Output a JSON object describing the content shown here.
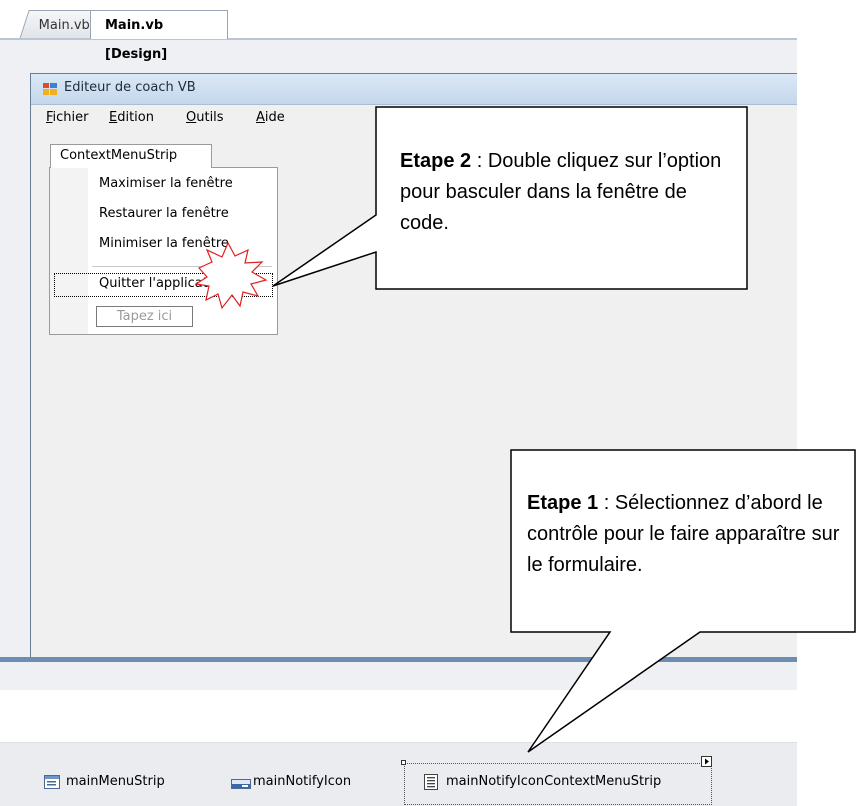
{
  "tabs": [
    {
      "label": "Main.vb",
      "active": false
    },
    {
      "label": "Main.vb [Design]",
      "active": true
    }
  ],
  "form": {
    "title": "Editeur de coach VB",
    "menu": [
      {
        "label": "Fichier",
        "mnemonic": "F",
        "rest": "ichier"
      },
      {
        "label": "Edition",
        "mnemonic": "E",
        "rest": "dition"
      },
      {
        "label": "Outils",
        "mnemonic": "O",
        "rest": "utils"
      },
      {
        "label": "Aide",
        "mnemonic": "A",
        "rest": "ide"
      }
    ]
  },
  "context_menu": {
    "tab_label": "ContextMenuStrip",
    "items": [
      "Maximiser la fenêtre",
      "Restaurer la fenêtre",
      "Minimiser la fenêtre",
      "Quitter l'application"
    ],
    "selected_item": "Quitter l'application",
    "type_here": "Tapez ici"
  },
  "callouts": {
    "step2": {
      "bold": "Etape 2",
      "text": " : Double cliquez sur l’option pour basculer dans la fenêtre de code."
    },
    "step1": {
      "bold": "Etape 1",
      "text": " : Sélectionnez d’abord le contrôle pour le faire apparaître sur le formulaire."
    }
  },
  "tray": {
    "items": [
      {
        "label": "mainMenuStrip",
        "icon": "menustrip-icon"
      },
      {
        "label": "mainNotifyIcon",
        "icon": "notifyicon-icon"
      },
      {
        "label": "mainNotifyIconContextMenuStrip",
        "icon": "contextmenustrip-icon",
        "selected": true
      }
    ]
  },
  "colors": {
    "titlebar": "#c5d7ec",
    "frame": "#6d8db3",
    "burst": "#e02020"
  }
}
